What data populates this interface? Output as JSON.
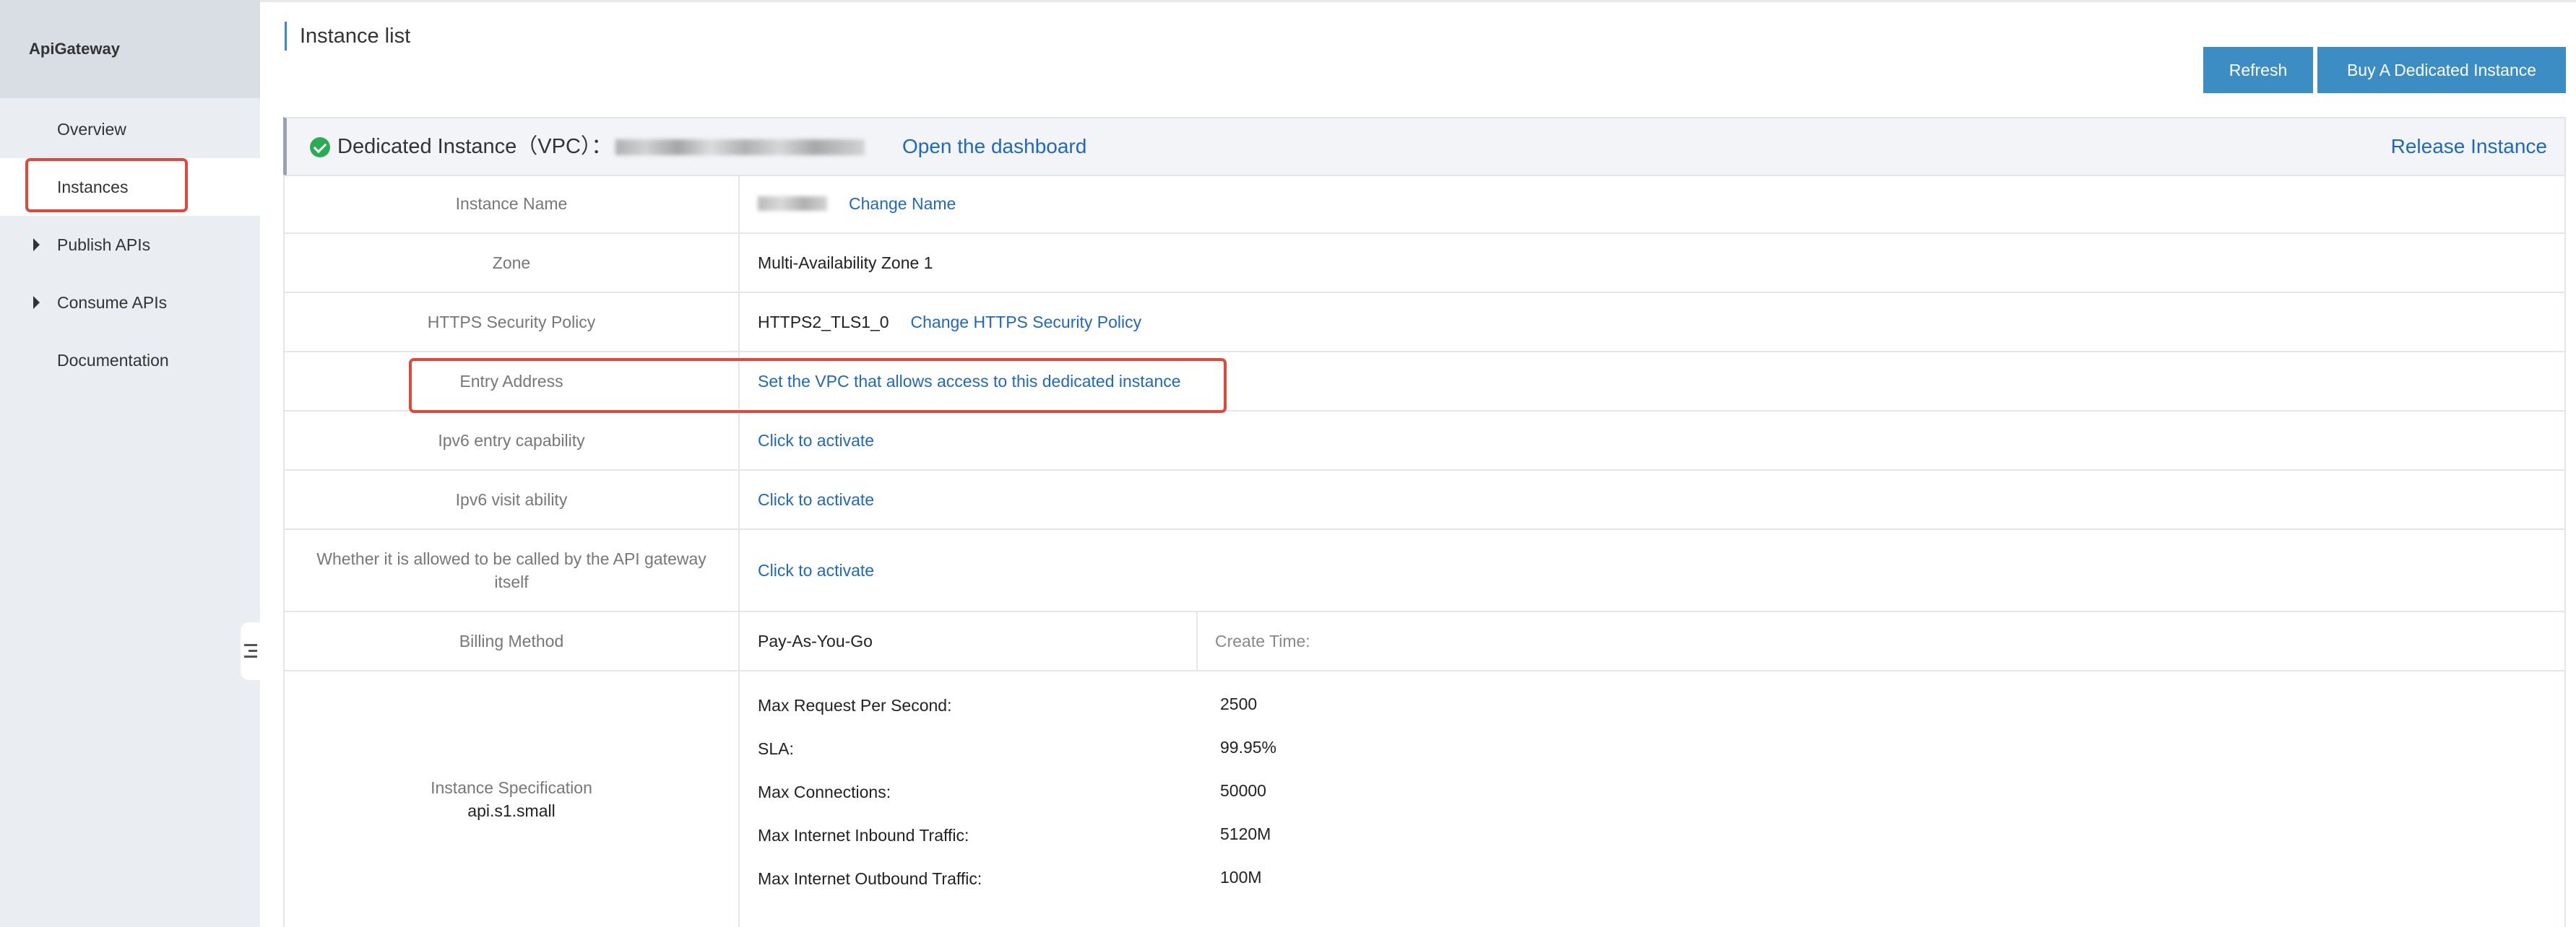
{
  "sidebar": {
    "brand": "ApiGateway",
    "items": [
      {
        "label": "Overview"
      },
      {
        "label": "Instances"
      },
      {
        "label": "Publish APIs"
      },
      {
        "label": "Consume APIs"
      },
      {
        "label": "Documentation"
      }
    ]
  },
  "header": {
    "title": "Instance list",
    "refresh_label": "Refresh",
    "buy_label": "Buy A Dedicated Instance"
  },
  "instance": {
    "label": "Dedicated Instance（VPC）：",
    "open_dashboard": "Open the dashboard",
    "release": "Release Instance"
  },
  "rows": {
    "name": {
      "label": "Instance Name",
      "action": "Change Name"
    },
    "zone": {
      "label": "Zone",
      "value": "Multi-Availability Zone 1"
    },
    "https": {
      "label": "HTTPS Security Policy",
      "value": "HTTPS2_TLS1_0",
      "action": "Change HTTPS Security Policy"
    },
    "entry": {
      "label": "Entry Address",
      "action": "Set the VPC that allows access to this dedicated instance"
    },
    "ipv6_entry": {
      "label": "Ipv6 entry capability",
      "action": "Click to activate"
    },
    "ipv6_visit": {
      "label": "Ipv6 visit ability",
      "action": "Click to activate"
    },
    "self_call": {
      "label": "Whether it is allowed to be called by the API gateway itself",
      "action": "Click to activate"
    },
    "billing": {
      "label": "Billing Method",
      "value": "Pay-As-You-Go",
      "create_time": "Create Time:"
    },
    "spec": {
      "label": "Instance Specification",
      "code": "api.s1.small",
      "items": [
        {
          "label": "Max Request Per Second:",
          "value": "2500"
        },
        {
          "label": "SLA:",
          "value": "99.95%"
        },
        {
          "label": "Max Connections:",
          "value": "50000"
        },
        {
          "label": "Max Internet Inbound Traffic:",
          "value": "5120M"
        },
        {
          "label": "Max Internet Outbound Traffic:",
          "value": "100M"
        }
      ]
    }
  },
  "colors": {
    "accent": "#3c8dc4",
    "link": "#1f68c2",
    "highlight": "#e1473b",
    "status_ok": "#2cab56"
  }
}
